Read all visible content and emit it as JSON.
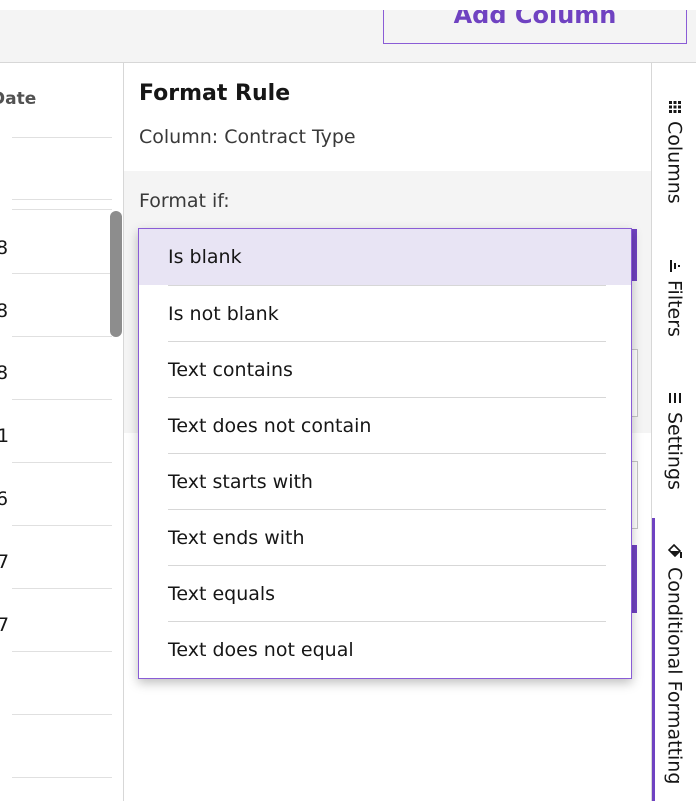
{
  "toolbar": {
    "add_column_label": "Add Column"
  },
  "grid": {
    "header": "Date",
    "rows": [
      "8",
      "8",
      "8",
      "1",
      "6",
      "7",
      "7"
    ]
  },
  "panel": {
    "title": "Format Rule",
    "subtitle": "Column: Contract Type",
    "format_if_label": "Format if:"
  },
  "dropdown": {
    "options": [
      "Is blank",
      "Is not blank",
      "Text contains",
      "Text does not contain",
      "Text starts with",
      "Text ends with",
      "Text equals",
      "Text does not equal"
    ],
    "selected": "Is blank"
  },
  "tabs": [
    {
      "label": "Columns",
      "icon": "grid-icon"
    },
    {
      "label": "Filters",
      "icon": "filter-icon"
    },
    {
      "label": "Settings",
      "icon": "settings-icon"
    },
    {
      "label": "Conditional Formatting",
      "icon": "paint-bucket-icon"
    }
  ],
  "colors": {
    "accent": "#6f42c1",
    "selected_bg": "#e8e4f4"
  }
}
